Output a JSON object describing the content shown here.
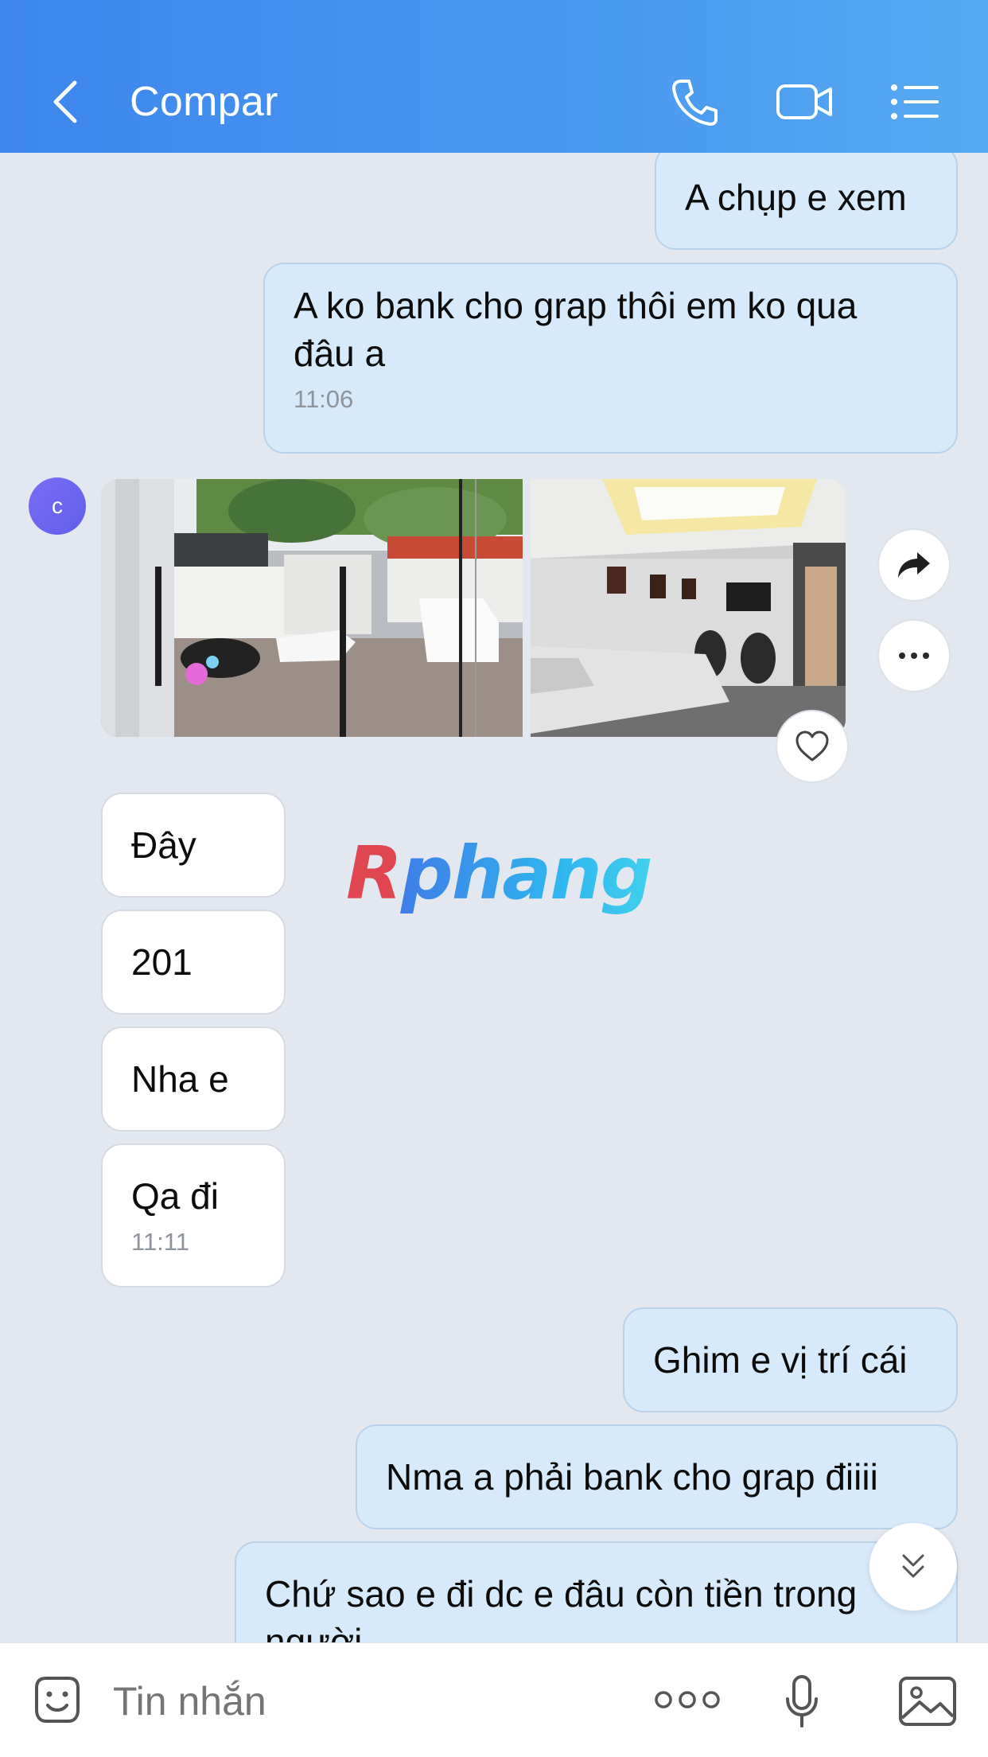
{
  "header": {
    "title": "Compar",
    "icons": [
      "back-chevron-icon",
      "phone-icon",
      "video-call-icon",
      "menu-list-icon"
    ]
  },
  "contact": {
    "avatar_initial": "c"
  },
  "messages": [
    {
      "from": "me",
      "text": "A chụp e xem"
    },
    {
      "from": "me",
      "text": "A ko bank cho grap thôi em ko qua đâu a",
      "time": "11:06"
    },
    {
      "from": "them",
      "type": "photos",
      "count": 2
    },
    {
      "from": "them",
      "text": "Đây"
    },
    {
      "from": "them",
      "text": "201"
    },
    {
      "from": "them",
      "text": "Nha e"
    },
    {
      "from": "them",
      "text": "Qa đi",
      "time": "11:11"
    },
    {
      "from": "me",
      "text": "Ghim e vị trí cái"
    },
    {
      "from": "me",
      "text": "Nma a phải bank cho grap điiii"
    },
    {
      "from": "me",
      "text": "Chứ sao e đi dc e đâu còn tiền trong người"
    }
  ],
  "watermark": "Rphang",
  "input": {
    "placeholder": "Tin nhắn",
    "icons": [
      "sticker-icon",
      "more-dots-icon",
      "microphone-icon",
      "image-icon"
    ]
  },
  "colors": {
    "header_start": "#3d86ee",
    "header_end": "#56aaf0",
    "chat_background": "#e3e8f0",
    "my_bubble": "#d6eafc",
    "their_bubble": "#ffffff"
  }
}
